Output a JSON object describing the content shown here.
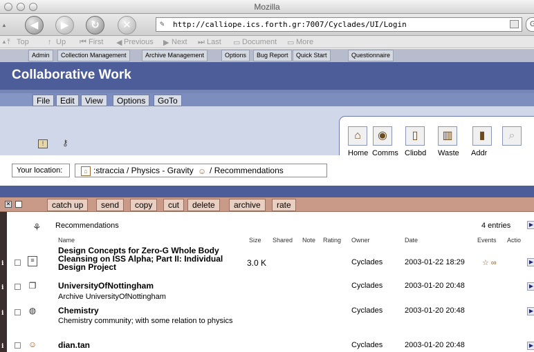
{
  "window": {
    "title": "Mozilla"
  },
  "nav": {
    "url": "http://calliope.ics.forth.gr:7007/Cyclades/UI/Login",
    "search_prefix": "G"
  },
  "site_nav": {
    "items": [
      "Top",
      "Up",
      "First",
      "Previous",
      "Next",
      "Last",
      "Document",
      "More"
    ]
  },
  "admin_menu": {
    "items": [
      "Admin",
      "Collection Management",
      "Archive Management",
      "Options",
      "Bug Report",
      "Quick Start",
      "Questionnaire"
    ]
  },
  "header": {
    "title": "Collaborative Work"
  },
  "menubar": {
    "items": [
      "File",
      "Edit",
      "View",
      "Options",
      "GoTo"
    ]
  },
  "toolbar": {
    "items": [
      {
        "label": "Home",
        "icon": "home-icon",
        "glyph": "⌂"
      },
      {
        "label": "Comms",
        "icon": "comms-icon",
        "glyph": "◉"
      },
      {
        "label": "Clipbd",
        "icon": "clipboard-icon",
        "glyph": "▯"
      },
      {
        "label": "Waste",
        "icon": "waste-icon",
        "glyph": "▥"
      },
      {
        "label": "Addr",
        "icon": "address-book-icon",
        "glyph": "▮"
      },
      {
        "label": "",
        "icon": "search-icon",
        "glyph": "⌕"
      }
    ]
  },
  "location": {
    "label": "Your location:",
    "path": ":straccia / Physics - Gravity",
    "path_end": "/ Recommendations"
  },
  "actions": {
    "items": [
      "catch up",
      "send",
      "copy",
      "cut",
      "delete",
      "archive",
      "rate"
    ]
  },
  "list": {
    "title": "Recommendations",
    "count": "4 entries",
    "columns": [
      "Name",
      "Size",
      "Shared",
      "Note",
      "Rating",
      "Owner",
      "Date",
      "Events",
      "Actio"
    ],
    "rows": [
      {
        "type_icon": "document-icon",
        "name": "Design Concepts for Zero-G Whole Body Cleansing on ISS Alpha; Part II: Individual Design Project",
        "desc": "",
        "size": "3.0 K",
        "owner": "Cyclades",
        "date": "2003-01-22 18:29",
        "events": "☆ ∞"
      },
      {
        "type_icon": "archive-icon",
        "name": "UniversityOfNottingham",
        "desc": "Archive UniversityOfNottingham",
        "size": "",
        "owner": "Cyclades",
        "date": "2003-01-20 20:48",
        "events": ""
      },
      {
        "type_icon": "globe-icon",
        "name": "Chemistry",
        "desc": "Chemistry community; with some relation to physics",
        "size": "",
        "owner": "Cyclades",
        "date": "2003-01-20 20:48",
        "events": ""
      },
      {
        "type_icon": "person-icon",
        "name": "dian.tan",
        "desc": "",
        "size": "",
        "owner": "Cyclades",
        "date": "2003-01-20 20:48",
        "events": ""
      }
    ]
  },
  "colors": {
    "header_bg": "#4c5d99",
    "menubar_bg": "#7d8ebe",
    "action_bar_bg": "#c99a87"
  }
}
